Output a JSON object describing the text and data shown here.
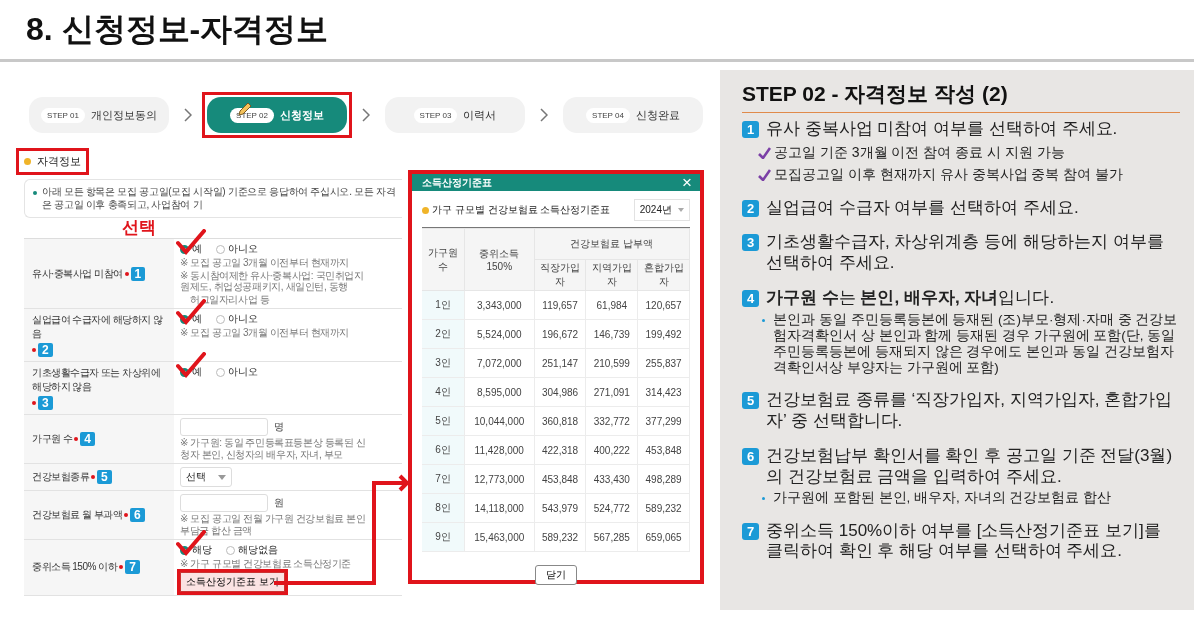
{
  "slide_title": "8. 신청정보-자격정보",
  "steps": [
    {
      "num": "STEP 01",
      "label": "개인정보동의",
      "selected": false,
      "highlighted": false
    },
    {
      "num": "STEP 02",
      "label": "신청정보",
      "selected": true,
      "highlighted": true
    },
    {
      "num": "STEP 03",
      "label": "이력서",
      "selected": false,
      "highlighted": false
    },
    {
      "num": "STEP 04",
      "label": "신청완료",
      "selected": false,
      "highlighted": false
    }
  ],
  "section": {
    "label": "자격정보",
    "highlighted": true
  },
  "notice": "아래 모든 항목은 모집 공고일(모집 시작일) 기준으로 응답하여 주십시오. 모든 자격은 공고일 이후 충족되고, 사업참여 기",
  "annotation_label": "선택",
  "form_rows": [
    {
      "label": "유사·중복사업 미참여",
      "badge": "1",
      "kind": "radio",
      "options": [
        {
          "label": "예",
          "selected": true
        },
        {
          "label": "아니오",
          "selected": false
        }
      ],
      "notes": [
        "※ 모집 공고일 3개월 이전부터 현재까지",
        "※ 동시참여제한 유사·중복사업: 국민취업지원제도, 취업성공패키지, 새일인턴, 동행",
        "허그일자리사업 등"
      ],
      "marked": true
    },
    {
      "label": "실업급여 수급자에 해당하지 않음",
      "badge": "2",
      "kind": "radio",
      "options": [
        {
          "label": "예",
          "selected": true
        },
        {
          "label": "아니오",
          "selected": false
        }
      ],
      "notes": [
        "※ 모집 공고일 3개월 이전부터 현재까지"
      ],
      "marked": true
    },
    {
      "label": "기초생활수급자 또는 차상위에 해당하지 않음",
      "badge": "3",
      "kind": "radio",
      "options": [
        {
          "label": "예",
          "selected": true
        },
        {
          "label": "아니오",
          "selected": false
        }
      ],
      "marked": true
    },
    {
      "label": "가구원 수",
      "badge": "4",
      "kind": "input",
      "unit": "명",
      "notes": [
        "※ 가구원: 동일 주민등록표등본상 등록된 신청자 본인, 신청자의 배우자, 자녀, 부모"
      ],
      "marked": false
    },
    {
      "label": "건강보험종류",
      "badge": "5",
      "kind": "select",
      "value": "선택",
      "marked": false
    },
    {
      "label": "건강보험료 월 부과액",
      "badge": "6",
      "kind": "input",
      "unit": "원",
      "notes": [
        "※ 모집 공고일 전월 가구원 건강보험료 본인부담금 합산 금액"
      ],
      "marked": false
    },
    {
      "label": "중위소득 150% 이하",
      "badge": "7",
      "kind": "radio",
      "options": [
        {
          "label": "해당",
          "selected": true
        },
        {
          "label": "해당없음",
          "selected": false
        }
      ],
      "notes": [
        "※ 가구 규모별 건강보험료 소득산정기준"
      ],
      "button": {
        "label": "소득산정기준표 보기",
        "highlighted": true
      },
      "marked": true
    }
  ],
  "modal": {
    "title": "소득산정기준표",
    "close": "×",
    "subtitle": "가구 규모별 건강보험료 소득산정기준표",
    "year": "2024년",
    "table": {
      "columns": [
        "가구원 수",
        "중위소득 150%"
      ],
      "group": "건강보험료 납부액",
      "subcolumns": [
        "직장가입자",
        "지역가입자",
        "혼합가입자"
      ],
      "rows": [
        [
          "1인",
          "3,343,000",
          "119,657",
          "61,984",
          "120,657"
        ],
        [
          "2인",
          "5,524,000",
          "196,672",
          "146,739",
          "199,492"
        ],
        [
          "3인",
          "7,072,000",
          "251,147",
          "210,599",
          "255,837"
        ],
        [
          "4인",
          "8,595,000",
          "304,986",
          "271,091",
          "314,423"
        ],
        [
          "5인",
          "10,044,000",
          "360,818",
          "332,772",
          "377,299"
        ],
        [
          "6인",
          "11,428,000",
          "422,318",
          "400,222",
          "453,848"
        ],
        [
          "7인",
          "12,773,000",
          "453,848",
          "433,430",
          "498,289"
        ],
        [
          "8인",
          "14,118,000",
          "543,979",
          "524,772",
          "589,232"
        ],
        [
          "9인",
          "15,463,000",
          "589,232",
          "567,285",
          "659,065"
        ]
      ]
    },
    "button": "닫기",
    "highlighted": true
  },
  "guide": {
    "title": "STEP 02 - 자격정보 작성 (2)",
    "items": [
      {
        "num": "1",
        "text": "유사 중복사업 미참여 여부를 선택하여 주세요.",
        "checks": [
          "공고일 기준 3개월 이전 참여 종료 시 지원 가능",
          "모집공고일 이후 현재까지 유사 중복사업 중복 참여 불가"
        ]
      },
      {
        "num": "2",
        "text": "실업급여 수급자 여부를 선택하여 주세요."
      },
      {
        "num": "3",
        "text": "기초생활수급자, 차상위계층 등에 해당하는지 여부를 선택하여 주세요."
      },
      {
        "num": "4",
        "text": "**가구원 수**는 **본인, 배우자, 자녀**입니다.",
        "notes": [
          "본인과 동일 주민등록등본에 등재된 (조)부모·형제·자매 중 건강보험자격확인서 상 본인과 함께 등재된 경우 가구원에 포함(단, 동일 주민등록등본에 등재되지 않은 경우에도 본인과 동일 건강보험자격확인서상 부양자는 가구원에 포함)"
        ]
      },
      {
        "num": "5",
        "text": "건강보험료 종류를 ‘직장가입자, 지역가입자, 혼합가입자’ 중 선택합니다."
      },
      {
        "num": "6",
        "text": "건강보험납부 확인서를 확인 후 공고일 기준 전달(3월)의 건강보험료 금액을 입력하여 주세요.",
        "notes": [
          "가구원에 포함된 본인, 배우자, 자녀의 건강보험료 합산"
        ]
      },
      {
        "num": "7",
        "text": "중위소득 150%이하 여부를 [소득산정기준표 보기]를 클릭하여 확인 후 해당 여부를 선택하여 주세요."
      }
    ]
  }
}
